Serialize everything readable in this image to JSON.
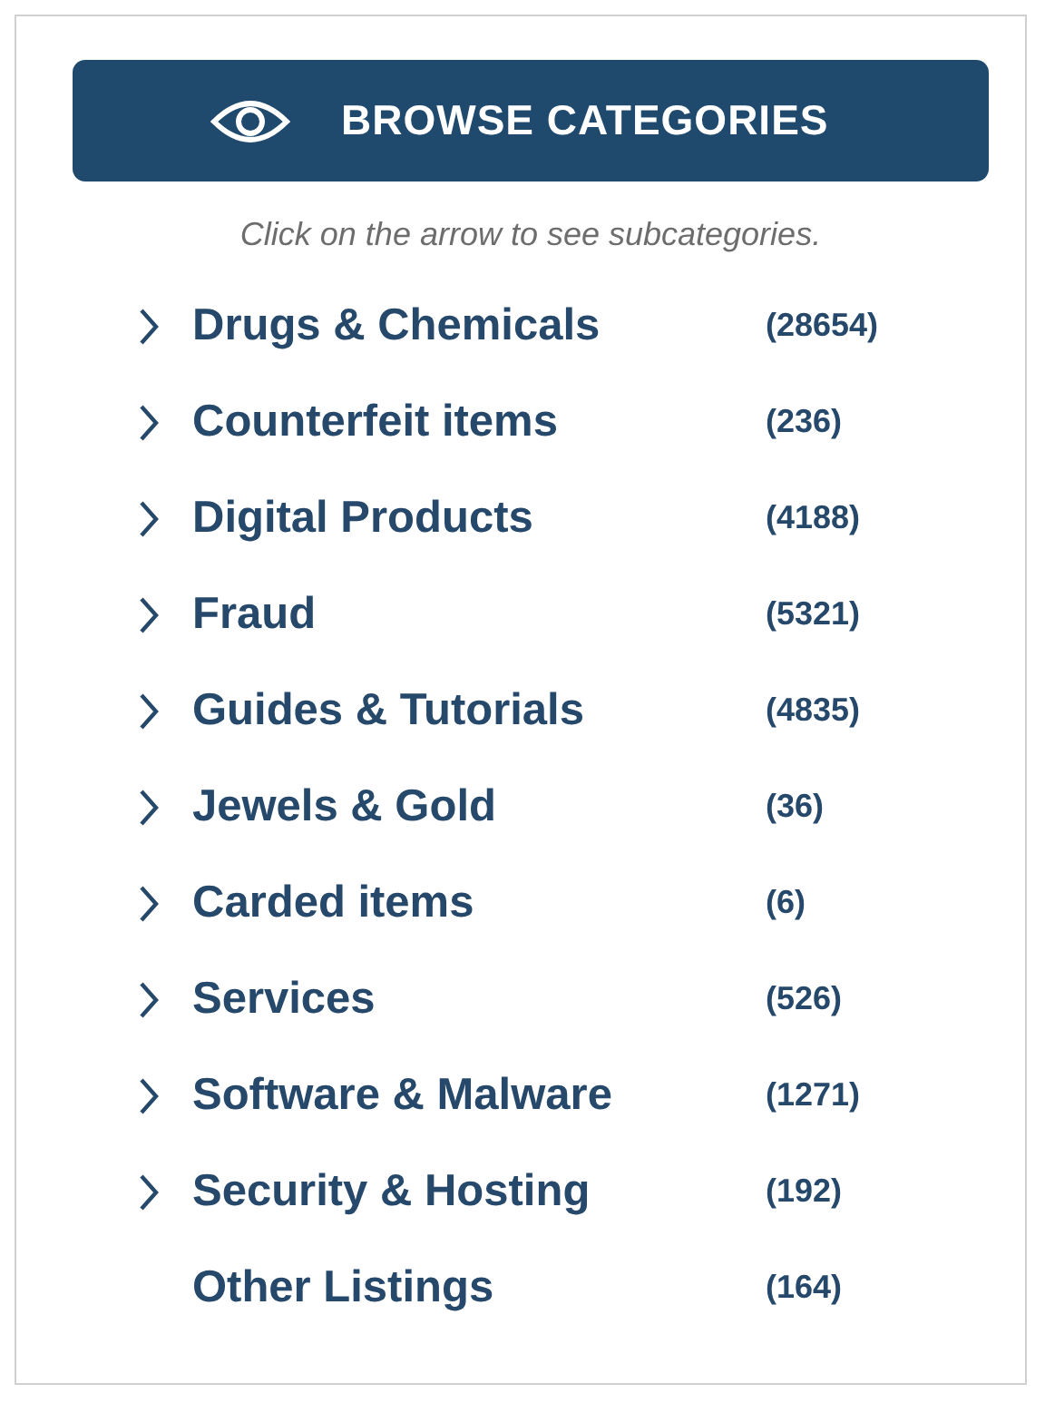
{
  "header": {
    "title": "BROWSE CATEGORIES"
  },
  "hint": "Click on the arrow to see subcategories.",
  "categories": [
    {
      "name": "Drugs & Chemicals",
      "count": "(28654)",
      "expandable": true
    },
    {
      "name": "Counterfeit items",
      "count": "(236)",
      "expandable": true
    },
    {
      "name": "Digital Products",
      "count": "(4188)",
      "expandable": true
    },
    {
      "name": "Fraud",
      "count": "(5321)",
      "expandable": true
    },
    {
      "name": "Guides & Tutorials",
      "count": "(4835)",
      "expandable": true
    },
    {
      "name": "Jewels & Gold",
      "count": "(36)",
      "expandable": true
    },
    {
      "name": "Carded items",
      "count": "(6)",
      "expandable": true
    },
    {
      "name": "Services",
      "count": "(526)",
      "expandable": true
    },
    {
      "name": "Software & Malware",
      "count": "(1271)",
      "expandable": true
    },
    {
      "name": "Security & Hosting",
      "count": "(192)",
      "expandable": true
    },
    {
      "name": "Other Listings",
      "count": "(164)",
      "expandable": false
    }
  ]
}
